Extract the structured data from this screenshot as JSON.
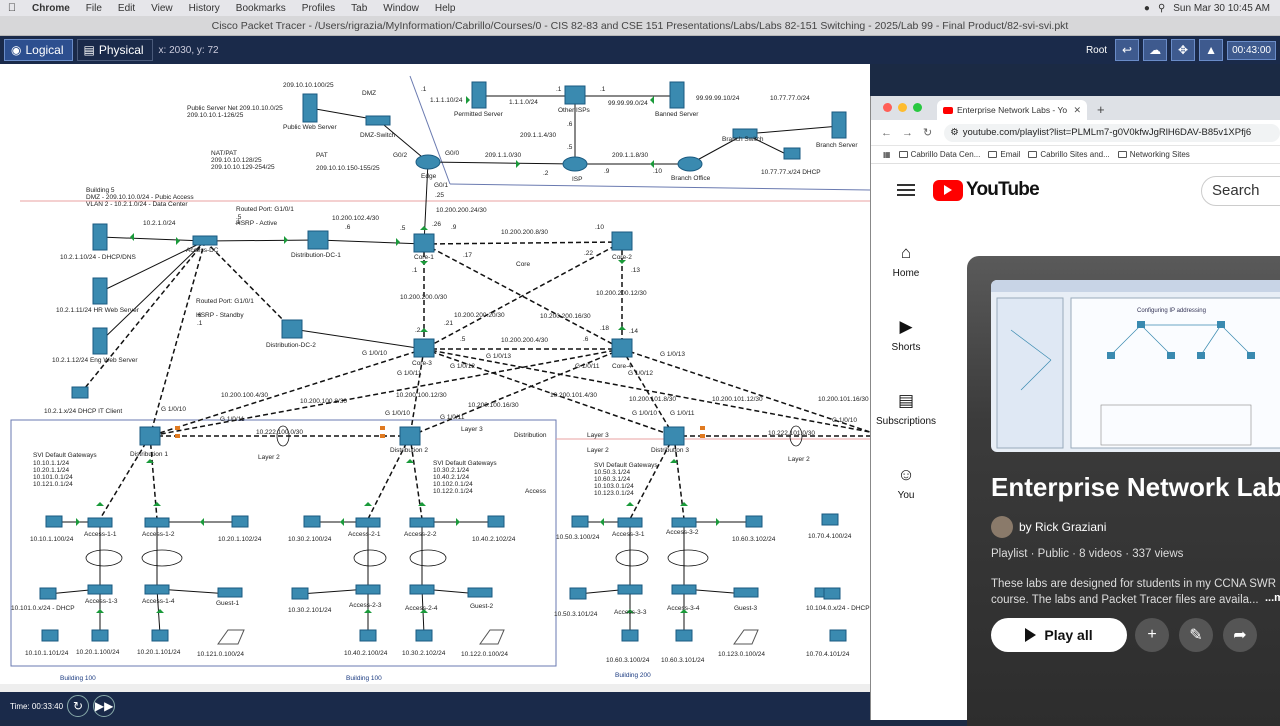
{
  "mac_menubar": {
    "app": "Chrome",
    "menus": [
      "File",
      "Edit",
      "View",
      "History",
      "Bookmarks",
      "Profiles",
      "Tab",
      "Window",
      "Help"
    ],
    "clock": "Sun Mar 30  10:45 AM"
  },
  "window_title": "Cisco Packet Tracer - /Users/rigrazia/MyInformation/Cabrillo/Courses/0 - CIS 82-83 and CSE 151 Presentations/Labs/Labs 82-151 Switching - 2025/Lab 99 - Final Product/82-svi-svi.pkt",
  "pt_toolbar": {
    "logical_tab": "Logical",
    "physical_tab": "Physical",
    "coords": "x: 2030, y: 72",
    "root": "Root",
    "clock": "00:43:00"
  },
  "pt_bottom": {
    "time": "Time: 00:33:40"
  },
  "topology": {
    "labels": [
      {
        "t": "209.10.10.100/25"
      },
      {
        "t": "DMZ"
      },
      {
        "t": "Public Server Net 209.10.10.0/25"
      },
      {
        "t": "209.10.10.1-126/25"
      },
      {
        "t": "Public Web Server"
      },
      {
        "t": "DMZ-Switch"
      },
      {
        "t": "1.1.1.10/24"
      },
      {
        "t": "1.1.1.0/24"
      },
      {
        "t": "Other ISPs"
      },
      {
        "t": "99.99.99.0/24"
      },
      {
        "t": "99.99.99.10/24"
      },
      {
        "t": "10.77.77.0/24"
      },
      {
        "t": "Permitted Server"
      },
      {
        "t": "Banned Server"
      },
      {
        "t": "209.1.1.4/30"
      },
      {
        "t": "Branch Switch"
      },
      {
        "t": "Branch Server"
      },
      {
        "t": "NAT/PAT"
      },
      {
        "t": "209.10.10.128/25"
      },
      {
        "t": "209.10.10.129-254/25"
      },
      {
        "t": "PAT"
      },
      {
        "t": "209.10.10.150-155/25"
      },
      {
        "t": "G0/2"
      },
      {
        "t": "G0/0"
      },
      {
        "t": "209.1.1.0/30"
      },
      {
        "t": "209.1.1.8/30"
      },
      {
        "t": "ISP"
      },
      {
        "t": "Branch Office"
      },
      {
        "t": "10.77.77.x/24 DHCP"
      },
      {
        "t": "Edge"
      },
      {
        "t": "G0/1"
      },
      {
        "t": "Building 5"
      },
      {
        "t": "DMZ - 209.10.10.0/24 - Pubic Access"
      },
      {
        "t": "VLAN 2 - 10.2.1.0/24 - Data Center"
      },
      {
        "t": "Routed Port: G1/0/1"
      },
      {
        "t": "HSRP - Active"
      },
      {
        "t": "10.200.200.24/30"
      },
      {
        "t": "10.2.1.0/24"
      },
      {
        "t": "10.200.102.4/30"
      },
      {
        "t": "10.200.200.8/30"
      },
      {
        "t": "10.2.1.10/24 - DHCP/DNS"
      },
      {
        "t": "Access-DC"
      },
      {
        "t": "Distribution-DC-1"
      },
      {
        "t": "Core-1"
      },
      {
        "t": "Core-2"
      },
      {
        "t": "Core"
      },
      {
        "t": "10.2.1.11/24 HR Web Server"
      },
      {
        "t": "Routed Port: G1/0/1"
      },
      {
        "t": "HSRP - Standby"
      },
      {
        "t": "10.200.200.0/30"
      },
      {
        "t": "10.200.200.20/30"
      },
      {
        "t": "10.200.200.16/30"
      },
      {
        "t": "10.200.200.12/30"
      },
      {
        "t": "10.2.1.12/24 Eng Web Server"
      },
      {
        "t": "Distribution-DC-2"
      },
      {
        "t": "G 1/0/10"
      },
      {
        "t": "G 1/0/11"
      },
      {
        "t": "Core-3"
      },
      {
        "t": "G 1/0/12"
      },
      {
        "t": "10.200.200.4/30"
      },
      {
        "t": "G 1/0/13"
      },
      {
        "t": "Core-4"
      },
      {
        "t": "G 1/0/11"
      },
      {
        "t": "G 1/0/12"
      },
      {
        "t": "G 1/0/13"
      },
      {
        "t": "10.2.1.x/24 DHCP IT Client"
      },
      {
        "t": "10.200.100.4/30"
      },
      {
        "t": "10.200.100.8/30"
      },
      {
        "t": "10.200.100.12/30"
      },
      {
        "t": "10.200.100.16/30"
      },
      {
        "t": "10.200.101.4/30"
      },
      {
        "t": "10.200.101.8/30"
      },
      {
        "t": "10.200.101.12/30"
      },
      {
        "t": "10.200.101.16/30"
      },
      {
        "t": "G 1/0/10"
      },
      {
        "t": "G 1/0/11"
      },
      {
        "t": "G 1/0/10"
      },
      {
        "t": "G 1/0/11"
      },
      {
        "t": "G 1/0/10"
      },
      {
        "t": "G 1/0/11"
      },
      {
        "t": "G 1/0/10"
      },
      {
        "t": "10.222.100.0/30"
      },
      {
        "t": "10.222.101.0/30"
      },
      {
        "t": "Layer 3"
      },
      {
        "t": "Layer 3"
      },
      {
        "t": "Distribution"
      },
      {
        "t": "Distribution 1"
      },
      {
        "t": "Distribution 2"
      },
      {
        "t": "Distribution 3"
      },
      {
        "t": "Layer 2"
      },
      {
        "t": "Layer 2"
      },
      {
        "t": "Layer 2"
      },
      {
        "t": "SVI Default Gateways"
      },
      {
        "t": "10.10.1.1/24"
      },
      {
        "t": "10.20.1.1/24"
      },
      {
        "t": "10.101.0.1/24"
      },
      {
        "t": "10.121.0.1/24"
      },
      {
        "t": "SVI Default Gateways"
      },
      {
        "t": "10.30.2.1/24"
      },
      {
        "t": "10.40.2.1/24"
      },
      {
        "t": "10.102.0.1/24"
      },
      {
        "t": "10.122.0.1/24"
      },
      {
        "t": "SVI Default Gateways"
      },
      {
        "t": "10.50.3.1/24"
      },
      {
        "t": "10.60.3.1/24"
      },
      {
        "t": "10.103.0.1/24"
      },
      {
        "t": "10.123.0.1/24"
      },
      {
        "t": "Access"
      },
      {
        "t": "10.10.1.100/24"
      },
      {
        "t": "Access-1-1"
      },
      {
        "t": "Access-1-2"
      },
      {
        "t": "10.20.1.102/24"
      },
      {
        "t": "10.30.2.100/24"
      },
      {
        "t": "Access-2-1"
      },
      {
        "t": "Access-2-2"
      },
      {
        "t": "10.40.2.102/24"
      },
      {
        "t": "10.50.3.100/24"
      },
      {
        "t": "Access-3-1"
      },
      {
        "t": "Access-3-2"
      },
      {
        "t": "10.60.3.102/24"
      },
      {
        "t": "10.70.4.100/24"
      },
      {
        "t": "10.101.0.x/24 - DHCP"
      },
      {
        "t": "Access-1-3"
      },
      {
        "t": "Access-1-4"
      },
      {
        "t": "Guest-1"
      },
      {
        "t": "10.30.2.101/24"
      },
      {
        "t": "Access-2-3"
      },
      {
        "t": "Access-2-4"
      },
      {
        "t": "Guest-2"
      },
      {
        "t": "10.50.3.101/24"
      },
      {
        "t": "Access-3-3"
      },
      {
        "t": "Access-3-4"
      },
      {
        "t": "Guest-3"
      },
      {
        "t": "10.104.0.x/24 - DHCP"
      },
      {
        "t": "10.10.1.101/24"
      },
      {
        "t": "10.20.1.100/24"
      },
      {
        "t": "10.20.1.101/24"
      },
      {
        "t": "10.121.0.100/24"
      },
      {
        "t": "10.40.2.100/24"
      },
      {
        "t": "10.30.2.102/24"
      },
      {
        "t": "10.122.0.100/24"
      },
      {
        "t": "10.60.3.100/24"
      },
      {
        "t": "10.60.3.101/24"
      },
      {
        "t": "10.123.0.100/24"
      },
      {
        "t": "10.70.4.101/24"
      },
      {
        "t": "Building 100"
      },
      {
        "t": "Building 100"
      },
      {
        "t": "Building 200"
      },
      {
        "t": ".1"
      },
      {
        "t": ".1"
      },
      {
        "t": ".1"
      },
      {
        "t": ".6"
      },
      {
        "t": ".5"
      },
      {
        "t": ".2"
      },
      {
        "t": ".9"
      },
      {
        "t": ".10"
      },
      {
        "t": ".25"
      },
      {
        "t": ".26"
      },
      {
        "t": ".9"
      },
      {
        "t": ".10"
      },
      {
        "t": ".17"
      },
      {
        "t": ".22"
      },
      {
        "t": ".13"
      },
      {
        "t": ".5"
      },
      {
        "t": ".6"
      },
      {
        "t": ".1"
      },
      {
        "t": ".2"
      },
      {
        "t": ".21"
      },
      {
        "t": ".5"
      },
      {
        "t": ".6"
      },
      {
        "t": ".18"
      },
      {
        "t": ".14"
      },
      {
        "t": ".1"
      },
      {
        "t": ".6"
      },
      {
        "t": ".1"
      },
      {
        "t": ".5"
      }
    ]
  },
  "browser": {
    "tab_title": "Enterprise Network Labs - Yo",
    "url": "youtube.com/playlist?list=PLMLm7-g0V0kfwJgRlH6DAV-B85v1XPfj6",
    "bookmarks": [
      "Cabrillo Data Cen...",
      "Email",
      "Cabrillo Sites and...",
      "Networking Sites"
    ],
    "youtube": {
      "logo_text": "YouTube",
      "search_placeholder": "Search",
      "sidebar": [
        "Home",
        "Shorts",
        "Subscriptions",
        "You"
      ],
      "playlist_title": "Enterprise Network Labs",
      "author": "by Rick Graziani",
      "meta": "Playlist · Public · 8 videos · 337 views",
      "description": "These labs are designed for students in my CCNA SWR course. The labs and Packet Tracer files are availa...",
      "more": "...m",
      "play_all": "Play all",
      "thumb_title": "Configuring IP addressing"
    }
  },
  "colors": {
    "pt_bar": "#1a2a4a",
    "yt_red": "#ff0000",
    "link_green": "#1a9a3a",
    "device_teal": "#3a8ab0"
  }
}
